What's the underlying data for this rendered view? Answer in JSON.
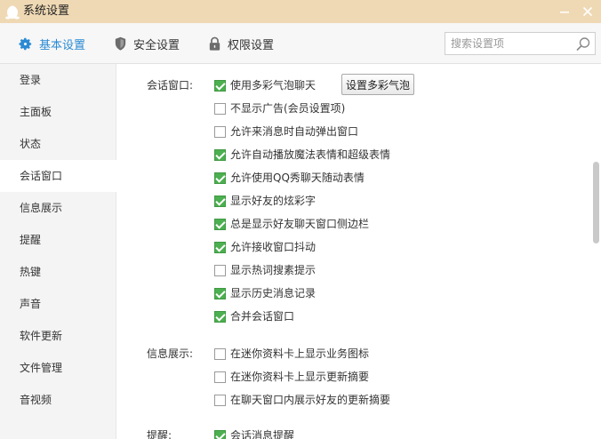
{
  "window": {
    "title": "系统设置",
    "app_icon": "penguin-icon",
    "minimize_icon": "minimize-icon",
    "close_icon": "close-icon"
  },
  "toolbar": {
    "tabs": [
      {
        "label": "基本设置",
        "icon": "gear-icon",
        "active": true
      },
      {
        "label": "安全设置",
        "icon": "shield-icon",
        "active": false
      },
      {
        "label": "权限设置",
        "icon": "lock-icon",
        "active": false
      }
    ],
    "search": {
      "placeholder": "搜索设置项",
      "value": "",
      "icon": "search-icon"
    },
    "active_color": "#2a8ad4"
  },
  "sidebar": {
    "items": [
      {
        "label": "登录"
      },
      {
        "label": "主面板"
      },
      {
        "label": "状态"
      },
      {
        "label": "会话窗口",
        "active": true
      },
      {
        "label": "信息展示"
      },
      {
        "label": "提醒"
      },
      {
        "label": "热键"
      },
      {
        "label": "声音"
      },
      {
        "label": "软件更新"
      },
      {
        "label": "文件管理"
      },
      {
        "label": "音视频"
      }
    ]
  },
  "content": {
    "sections": [
      {
        "label": "会话窗口:",
        "options": [
          {
            "label": "使用多彩气泡聊天",
            "checked": true
          },
          {
            "label": "不显示广告(会员设置项)",
            "checked": false
          },
          {
            "label": "允许来消息时自动弹出窗口",
            "checked": false
          },
          {
            "label": "允许自动播放魔法表情和超级表情",
            "checked": true
          },
          {
            "label": "允许使用QQ秀聊天随动表情",
            "checked": true
          },
          {
            "label": "显示好友的炫彩字",
            "checked": true
          },
          {
            "label": "总是显示好友聊天窗口侧边栏",
            "checked": true
          },
          {
            "label": "允许接收窗口抖动",
            "checked": true
          },
          {
            "label": "显示热词搜素提示",
            "checked": false
          },
          {
            "label": "显示历史消息记录",
            "checked": true
          },
          {
            "label": "合并会话窗口",
            "checked": true
          }
        ],
        "button_label": "设置多彩气泡"
      },
      {
        "label": "信息展示:",
        "options": [
          {
            "label": "在迷你资料卡上显示业务图标",
            "checked": false
          },
          {
            "label": "在迷你资料卡上显示更新摘要",
            "checked": false
          },
          {
            "label": "在聊天窗口内展示好友的更新摘要",
            "checked": false
          }
        ]
      },
      {
        "label": "提醒:",
        "options": [
          {
            "label": "会话消息提醒",
            "checked": true
          }
        ]
      }
    ],
    "check_color": "#4caf50"
  }
}
